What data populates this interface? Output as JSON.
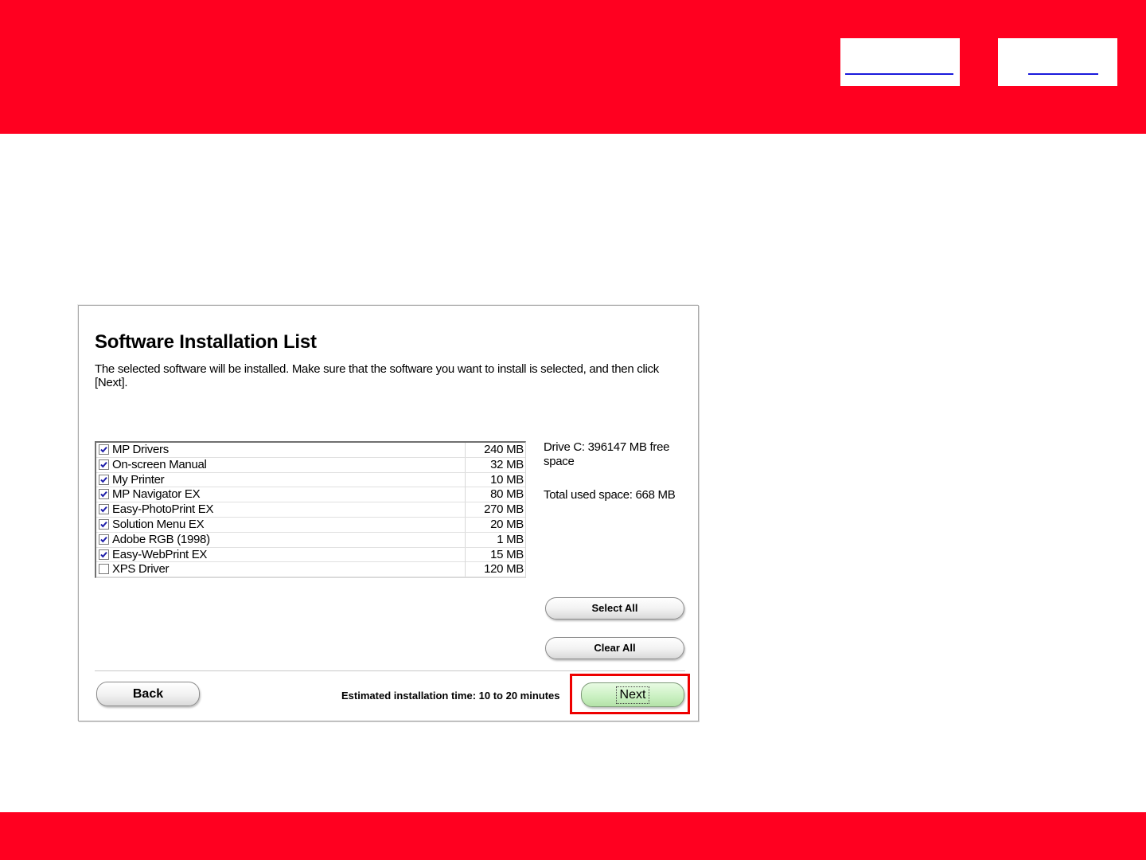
{
  "header": {
    "nav_links": [
      "",
      ""
    ]
  },
  "panel": {
    "title": "Software Installation List",
    "description": "The selected software will be installed. Make sure that the software you want to install is selected, and then click [Next].",
    "software": [
      {
        "name": "MP Drivers",
        "size": "240 MB",
        "checked": true
      },
      {
        "name": "On-screen Manual",
        "size": "32 MB",
        "checked": true
      },
      {
        "name": "My Printer",
        "size": "10 MB",
        "checked": true
      },
      {
        "name": "MP Navigator EX",
        "size": "80 MB",
        "checked": true
      },
      {
        "name": "Easy-PhotoPrint EX",
        "size": "270 MB",
        "checked": true
      },
      {
        "name": "Solution Menu EX",
        "size": "20 MB",
        "checked": true
      },
      {
        "name": "Adobe RGB (1998)",
        "size": "1 MB",
        "checked": true
      },
      {
        "name": "Easy-WebPrint EX",
        "size": "15 MB",
        "checked": true
      },
      {
        "name": "XPS Driver",
        "size": "120 MB",
        "checked": false
      }
    ],
    "drive_info": "Drive C: 396147 MB free space",
    "total_used": "Total used space: 668 MB",
    "select_all_label": "Select All",
    "clear_all_label": "Clear All",
    "back_label": "Back",
    "estimated_time": "Estimated installation time: 10 to 20 minutes",
    "next_label": "Next"
  },
  "colors": {
    "brand_red": "#ff0020",
    "highlight_red": "#ee0000",
    "next_button_green": "#c9f0c0",
    "link_blue": "#1a1adc"
  }
}
